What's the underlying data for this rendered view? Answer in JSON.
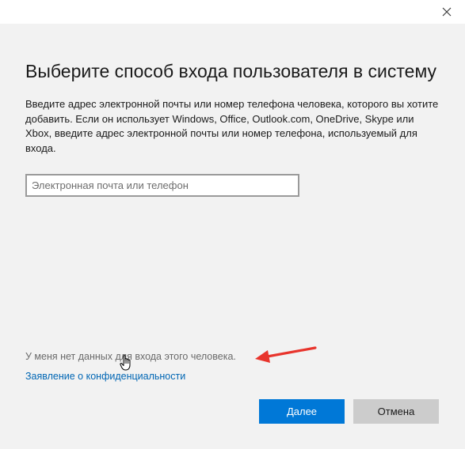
{
  "window": {
    "close_icon": "close-icon"
  },
  "page": {
    "title": "Выберите способ входа пользователя в систему",
    "description": "Введите адрес электронной почты или номер телефона человека, которого вы хотите добавить. Если он использует Windows, Office, Outlook.com, OneDrive, Skype или Xbox, введите адрес электронной почты или номер телефона, используемый для входа."
  },
  "form": {
    "email_placeholder": "Электронная почта или телефон",
    "email_value": ""
  },
  "links": {
    "no_account": "У меня нет данных для входа этого человека.",
    "privacy": "Заявление о конфиденциальности"
  },
  "buttons": {
    "next": "Далее",
    "cancel": "Отмена"
  },
  "annotations": {
    "arrow_icon": "red-arrow-icon",
    "arrow_color": "#e8342c",
    "cursor_icon": "hand-pointer-icon"
  },
  "colors": {
    "accent": "#0078d7",
    "link": "#0066b4",
    "background": "#f2f2f2"
  }
}
